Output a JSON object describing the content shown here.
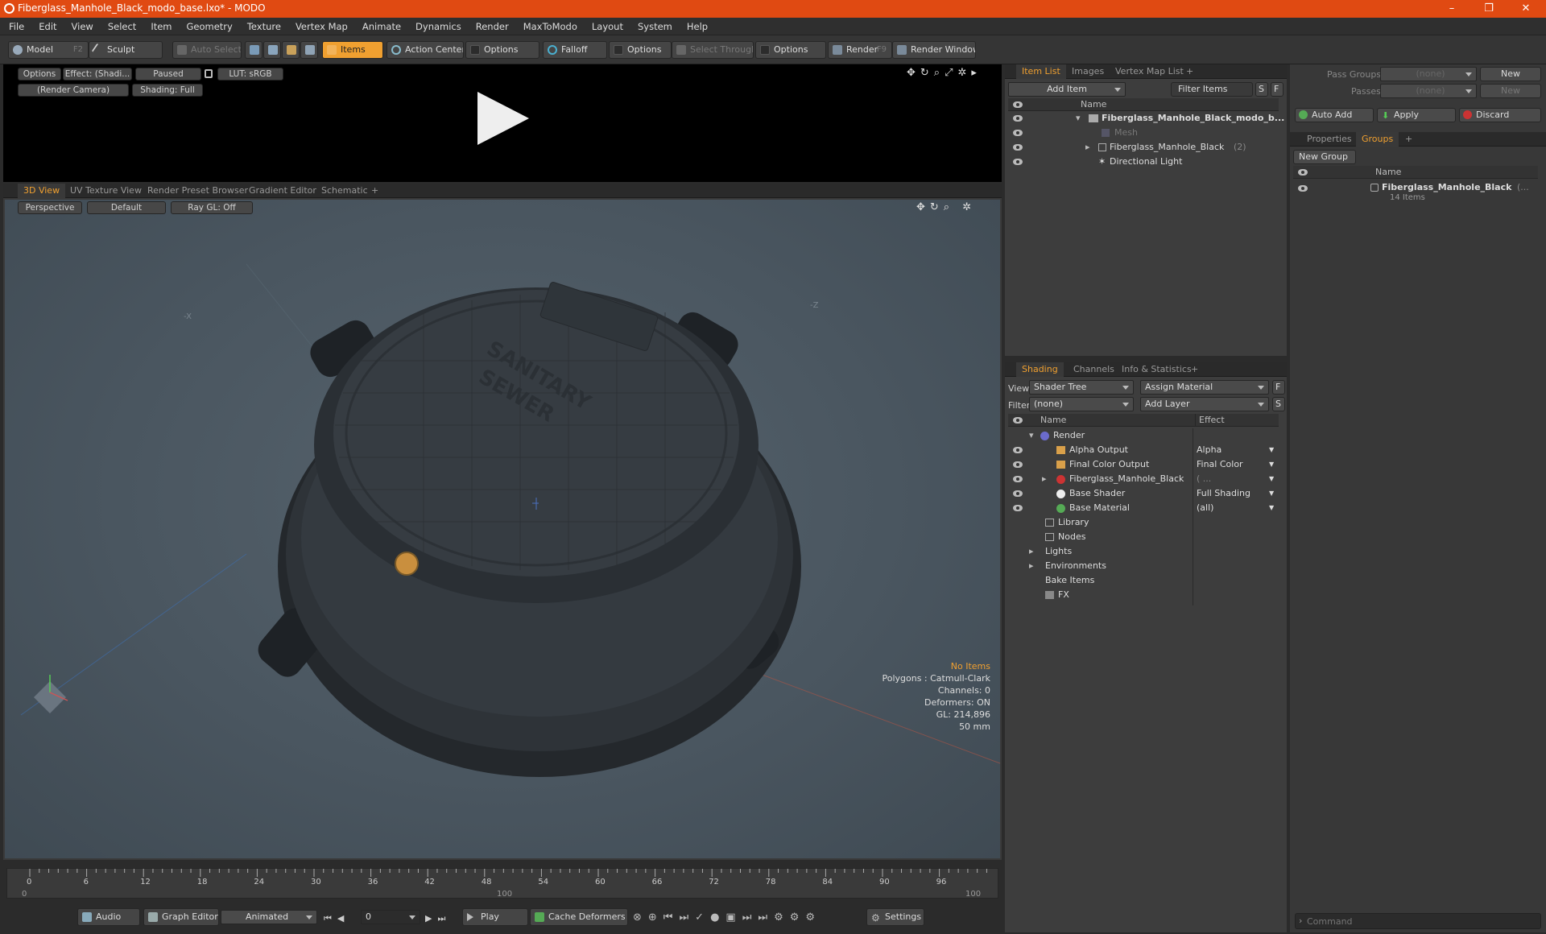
{
  "window": {
    "title": "Fiberglass_Manhole_Black_modo_base.lxo* - MODO",
    "min": "–",
    "max": "❐",
    "close": "✕"
  },
  "menu": [
    "File",
    "Edit",
    "View",
    "Select",
    "Item",
    "Geometry",
    "Texture",
    "Vertex Map",
    "Animate",
    "Dynamics",
    "Render",
    "MaxToModo",
    "Layout",
    "System",
    "Help"
  ],
  "toolbar": {
    "model": "Model",
    "model_key": "F2",
    "sculpt": "Sculpt",
    "auto_select": "Auto Select",
    "items": "Items",
    "action_center": "Action Center",
    "options1": "Options",
    "falloff": "Falloff",
    "options2": "Options",
    "select_through": "Select Through",
    "options3": "Options",
    "render": "Render",
    "render_key": "F9",
    "render_window": "Render Window"
  },
  "preview": {
    "options": "Options",
    "effect": "Effect: (Shadi...",
    "paused": "Paused",
    "lut": "LUT: sRGB",
    "camera": "(Render Camera)",
    "shading": "Shading: Full"
  },
  "viewport": {
    "tabs": [
      "3D View",
      "UV Texture View",
      "Render Preset Browser",
      "Gradient Editor",
      "Schematic"
    ],
    "perspective": "Perspective",
    "default": "Default",
    "raygl": "Ray GL: Off",
    "stats": {
      "no_items": "No Items",
      "polygons": "Polygons : Catmull-Clark",
      "channels": "Channels: 0",
      "deformers": "Deformers: ON",
      "gl": "GL: 214,896",
      "size": "50 mm"
    },
    "axis_labels": {
      "x": "-X",
      "z": "-Z"
    },
    "cover_text": [
      "SANITARY",
      "SEWER"
    ]
  },
  "timeline": {
    "ticks": [
      "0",
      "6",
      "12",
      "18",
      "24",
      "30",
      "36",
      "42",
      "48",
      "54",
      "60",
      "66",
      "72",
      "78",
      "84",
      "90",
      "96"
    ],
    "range_start": "0",
    "range_mid": "100",
    "range_end": "100"
  },
  "bottombar": {
    "audio": "Audio",
    "graph_editor": "Graph Editor",
    "animated": "Animated",
    "frame": "0",
    "play": "Play",
    "cache_deformers": "Cache Deformers",
    "settings": "Settings"
  },
  "itemlist": {
    "tabs": [
      "Item List",
      "Images",
      "Vertex Map List"
    ],
    "add_item": "Add Item",
    "filter_items": "Filter Items",
    "s": "S",
    "f": "F",
    "col_name": "Name",
    "rows": [
      {
        "name": "Fiberglass_Manhole_Black_modo_b...",
        "extra": ""
      },
      {
        "name": "Mesh",
        "extra": ""
      },
      {
        "name": "Fiberglass_Manhole_Black",
        "extra": "(2)"
      },
      {
        "name": "Directional Light",
        "extra": ""
      }
    ]
  },
  "shading": {
    "tabs": [
      "Shading",
      "Channels",
      "Info & Statistics"
    ],
    "view_label": "View",
    "view_value": "Shader Tree",
    "assign_material": "Assign Material",
    "f": "F",
    "filter_label": "Filter",
    "filter_value": "(none)",
    "add_layer": "Add Layer",
    "s": "S",
    "col_name": "Name",
    "col_effect": "Effect",
    "rows": [
      {
        "name": "Render",
        "effect": ""
      },
      {
        "name": "Alpha Output",
        "effect": "Alpha"
      },
      {
        "name": "Final Color Output",
        "effect": "Final Color"
      },
      {
        "name": "Fiberglass_Manhole_Black",
        "effect": "( ..."
      },
      {
        "name": "Base Shader",
        "effect": "Full Shading"
      },
      {
        "name": "Base Material",
        "effect": "(all)"
      },
      {
        "name": "Library",
        "effect": ""
      },
      {
        "name": "Nodes",
        "effect": ""
      },
      {
        "name": "Lights",
        "effect": ""
      },
      {
        "name": "Environments",
        "effect": ""
      },
      {
        "name": "Bake Items",
        "effect": ""
      },
      {
        "name": "FX",
        "effect": ""
      }
    ]
  },
  "groups": {
    "pass_groups": "Pass Groups",
    "pass_groups_value": "(none)",
    "new1": "New",
    "passes": "Passes",
    "passes_value": "(none)",
    "new2": "New",
    "auto_add": "Auto Add",
    "apply": "Apply",
    "discard": "Discard",
    "tabs": [
      "Properties",
      "Groups"
    ],
    "new_group": "New Group",
    "col_name": "Name",
    "item_name": "Fiberglass_Manhole_Black",
    "item_extra": "(...",
    "item_count": "14 Items"
  },
  "command": {
    "placeholder": "Command"
  },
  "colors": {
    "accent": "#f0a030",
    "titlebar": "#e04a12",
    "viewport_bg": "#4b5862"
  }
}
